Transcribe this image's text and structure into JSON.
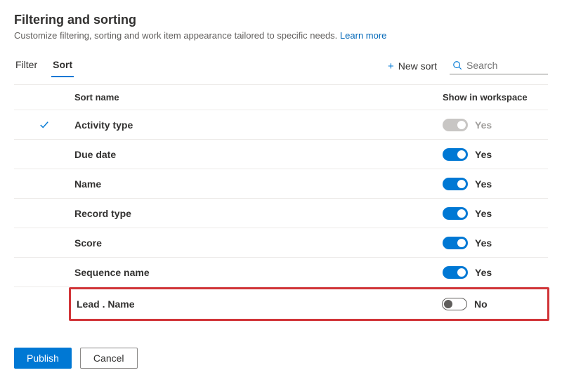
{
  "header": {
    "title": "Filtering and sorting",
    "description": "Customize filtering, sorting and work item appearance tailored to specific needs.",
    "learn_more": "Learn more"
  },
  "tabs": {
    "filter": "Filter",
    "sort": "Sort"
  },
  "toolbar": {
    "new_sort": "New sort",
    "search_placeholder": "Search"
  },
  "table": {
    "col_name": "Sort name",
    "col_show": "Show in workspace",
    "rows": [
      {
        "name": "Activity type",
        "enabled": true,
        "disabled_toggle": true,
        "label": "Yes",
        "checked": true
      },
      {
        "name": "Due date",
        "enabled": true,
        "disabled_toggle": false,
        "label": "Yes",
        "checked": false
      },
      {
        "name": "Name",
        "enabled": true,
        "disabled_toggle": false,
        "label": "Yes",
        "checked": false
      },
      {
        "name": "Record type",
        "enabled": true,
        "disabled_toggle": false,
        "label": "Yes",
        "checked": false
      },
      {
        "name": "Score",
        "enabled": true,
        "disabled_toggle": false,
        "label": "Yes",
        "checked": false
      },
      {
        "name": "Sequence name",
        "enabled": true,
        "disabled_toggle": false,
        "label": "Yes",
        "checked": false
      },
      {
        "name": "Lead . Name",
        "enabled": false,
        "disabled_toggle": false,
        "label": "No",
        "checked": false,
        "highlighted": true
      }
    ]
  },
  "footer": {
    "publish": "Publish",
    "cancel": "Cancel"
  }
}
